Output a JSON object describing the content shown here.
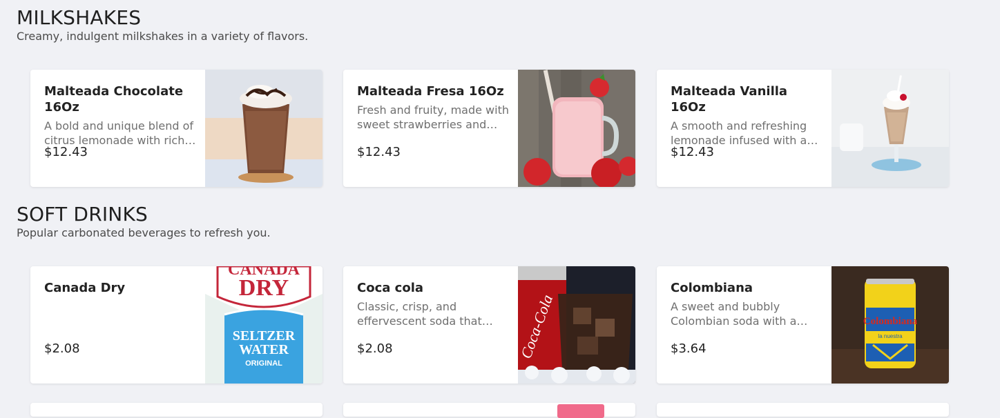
{
  "sections": [
    {
      "title": "MILKSHAKES",
      "description": "Creamy, indulgent milkshakes in a variety of flavors.",
      "items": [
        {
          "name": "Malteada Chocolate 16Oz",
          "description": "A bold and unique blend of citrus lemonade with rich…",
          "price": "$12.43",
          "image_icon": "chocolate-milkshake-photo"
        },
        {
          "name": "Malteada Fresa 16Oz",
          "description": "Fresh and fruity, made with sweet strawberries and…",
          "price": "$12.43",
          "image_icon": "strawberry-milkshake-photo"
        },
        {
          "name": "Malteada Vanilla 16Oz",
          "description": "A smooth and refreshing lemonade infused with a…",
          "price": "$12.43",
          "image_icon": "vanilla-milkshake-photo"
        }
      ]
    },
    {
      "title": "SOFT DRINKS",
      "description": "Popular carbonated beverages to refresh you.",
      "items": [
        {
          "name": "Canada Dry",
          "description": "",
          "price": "$2.08",
          "image_icon": "canada-dry-can-photo",
          "image_text": [
            "CANADA",
            "DRY",
            "SELTZER",
            "WATER",
            "ORIGINAL"
          ]
        },
        {
          "name": "Coca cola",
          "description": "Classic, crisp, and effervescent soda that…",
          "price": "$2.08",
          "image_icon": "coca-cola-glass-photo",
          "image_text": [
            "Coca-Cola"
          ]
        },
        {
          "name": "Colombiana",
          "description": "A sweet and bubbly Colombian soda with a…",
          "price": "$3.64",
          "image_icon": "colombiana-can-photo",
          "image_text": [
            "Colombiana",
            "la nuestra"
          ]
        }
      ]
    }
  ],
  "colors": {
    "background": "#f0f1f5",
    "card": "#ffffff",
    "text": "#222222",
    "muted": "#6f6f6f"
  }
}
